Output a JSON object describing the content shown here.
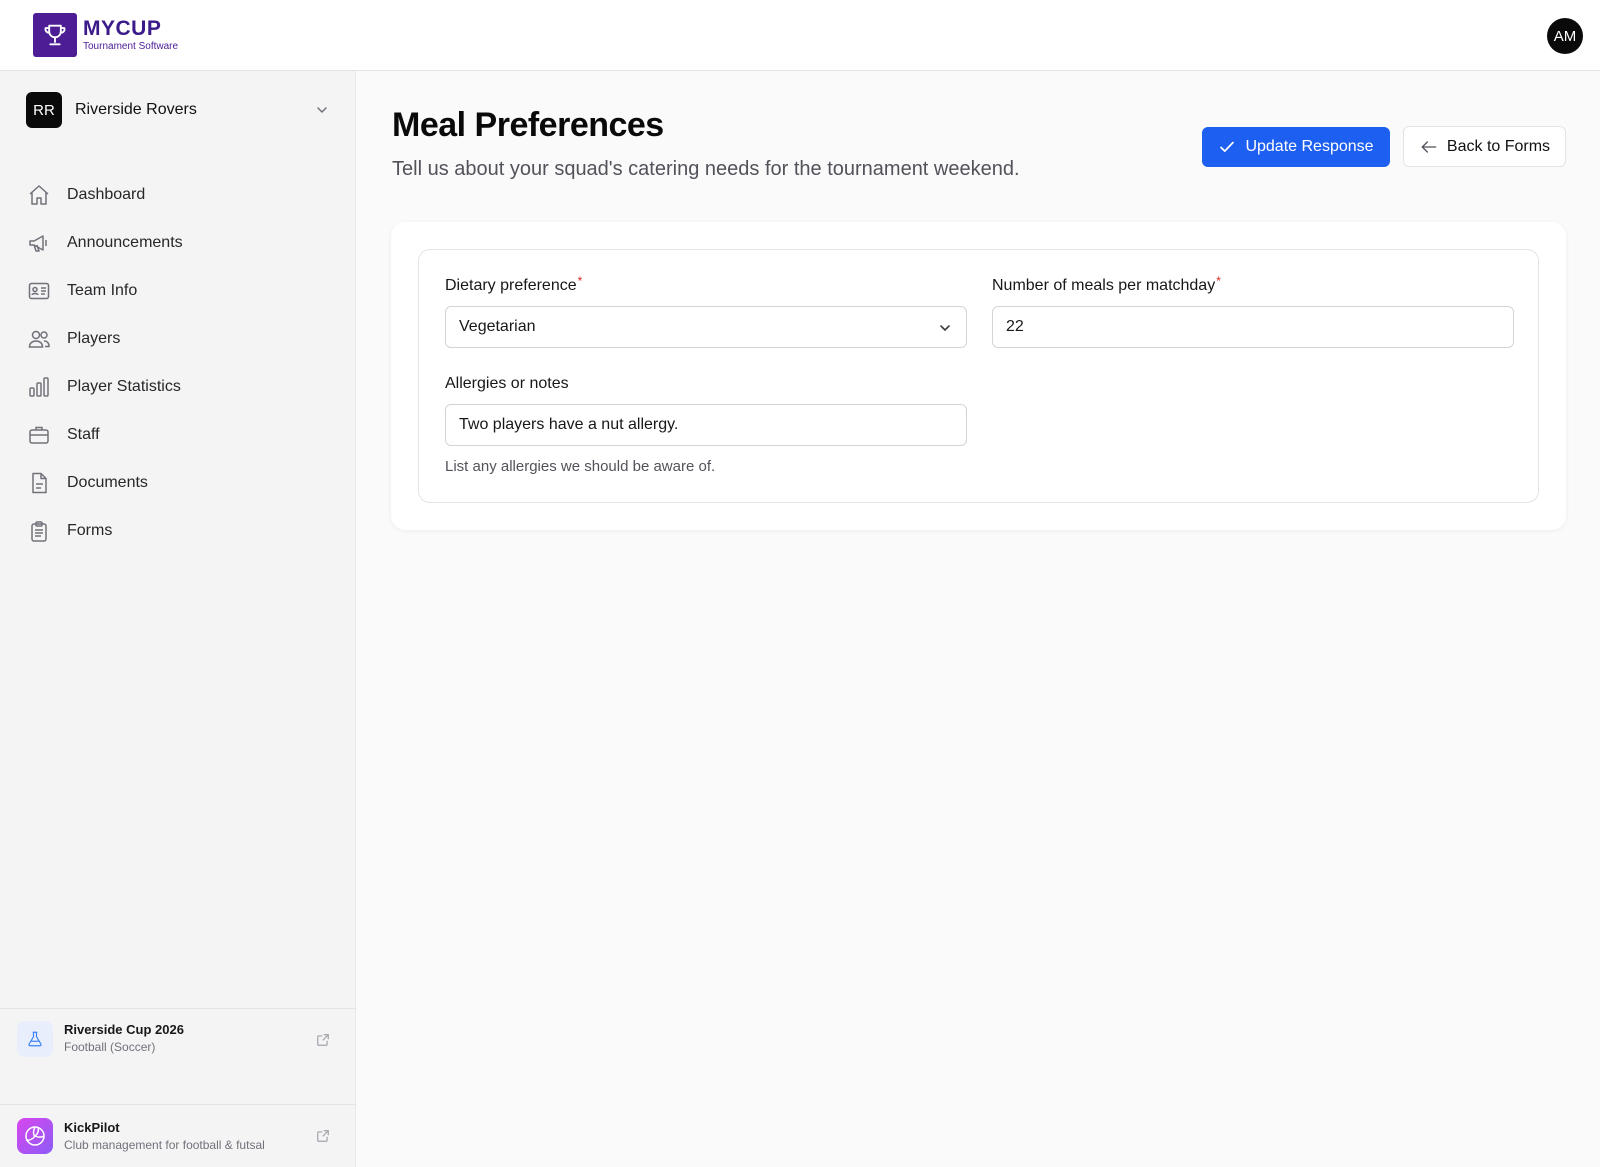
{
  "app": {
    "logo_name": "MYCUP",
    "logo_sub": "Tournament Software",
    "user_initials": "AM",
    "brand_color": "#4c1d95"
  },
  "team": {
    "initials": "RR",
    "name": "Riverside Rovers"
  },
  "nav": [
    {
      "label": "Dashboard",
      "icon": "home-icon"
    },
    {
      "label": "Announcements",
      "icon": "megaphone-icon"
    },
    {
      "label": "Team Info",
      "icon": "id-card-icon"
    },
    {
      "label": "Players",
      "icon": "users-icon"
    },
    {
      "label": "Player Statistics",
      "icon": "bar-chart-icon"
    },
    {
      "label": "Staff",
      "icon": "briefcase-icon"
    },
    {
      "label": "Documents",
      "icon": "document-icon"
    },
    {
      "label": "Forms",
      "icon": "clipboard-icon"
    }
  ],
  "tournament": {
    "title": "Riverside Cup 2026",
    "sport": "Football (Soccer)"
  },
  "partner": {
    "title": "KickPilot",
    "subtitle": "Club management for football & futsal"
  },
  "page": {
    "title": "Meal Preferences",
    "subtitle": "Tell us about your squad's catering needs for the tournament weekend.",
    "update_label": "Update Response",
    "back_label": "Back to Forms",
    "accent": "#1d5ff0"
  },
  "form": {
    "dietary": {
      "label": "Dietary preference",
      "required_mark": "*",
      "value": "Vegetarian"
    },
    "meals": {
      "label": "Number of meals per matchday",
      "required_mark": "*",
      "value": "22"
    },
    "allergies": {
      "label": "Allergies or notes",
      "value": "Two players have a nut allergy.",
      "help": "List any allergies we should be aware of."
    }
  }
}
